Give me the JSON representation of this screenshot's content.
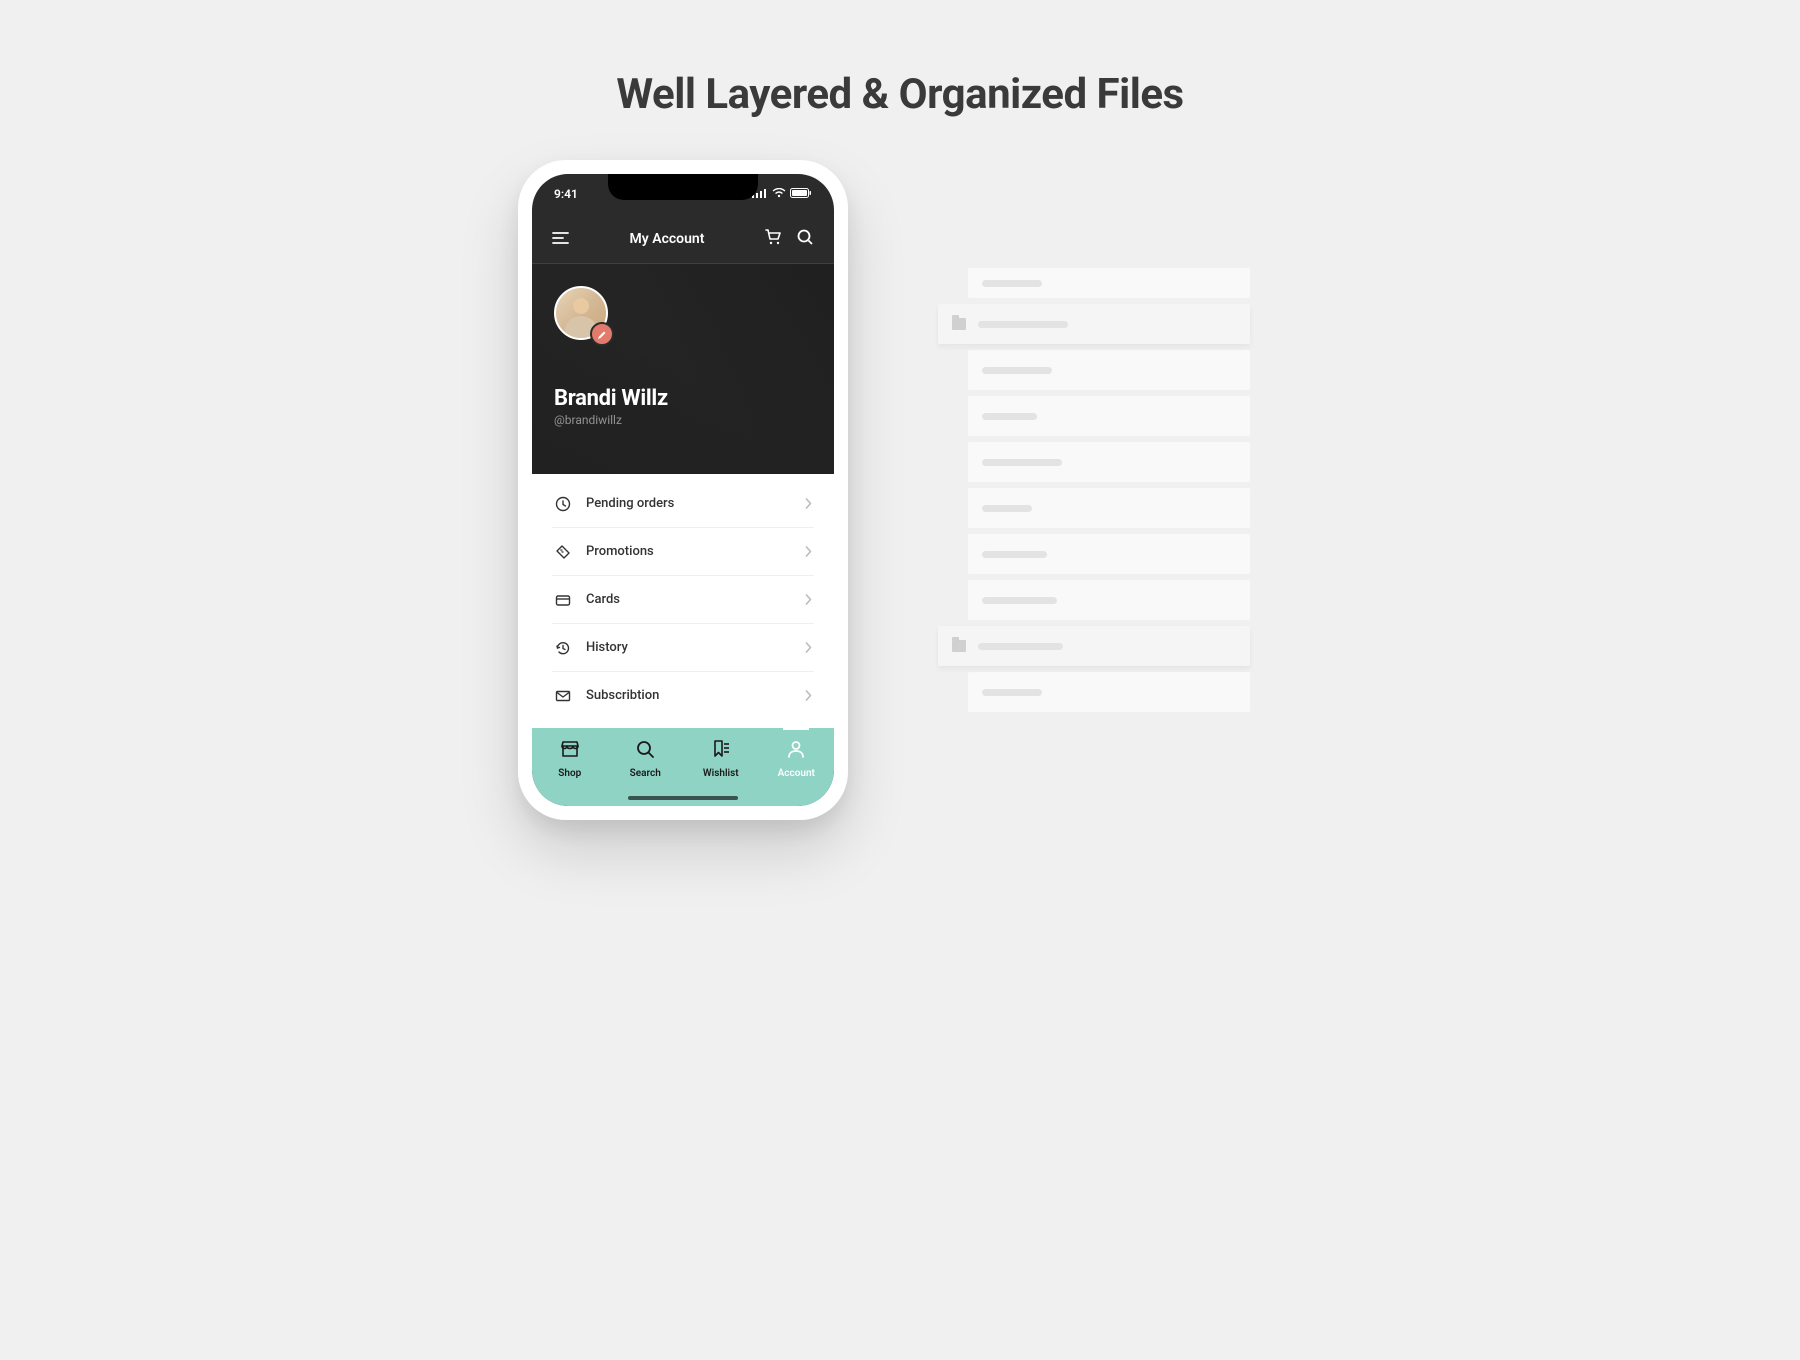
{
  "heading": "Well Layered & Organized Files",
  "statusbar": {
    "time": "9:41"
  },
  "topbar": {
    "title": "My Account"
  },
  "profile": {
    "name": "Brandi Willz",
    "handle": "@brandiwillz"
  },
  "menu": {
    "items": [
      {
        "icon": "clock-icon",
        "label": "Pending orders"
      },
      {
        "icon": "tag-icon",
        "label": "Promotions"
      },
      {
        "icon": "card-icon",
        "label": "Cards"
      },
      {
        "icon": "history-icon",
        "label": "History"
      },
      {
        "icon": "mail-icon",
        "label": "Subscribtion"
      }
    ]
  },
  "tabs": {
    "items": [
      {
        "icon": "shop-icon",
        "label": "Shop",
        "active": false
      },
      {
        "icon": "search-icon",
        "label": "Search",
        "active": false
      },
      {
        "icon": "wishlist-icon",
        "label": "Wishlist",
        "active": false
      },
      {
        "icon": "account-icon",
        "label": "Account",
        "active": true
      }
    ]
  },
  "colors": {
    "accent": "#8fd3c4",
    "edit_badge": "#e37b6d",
    "dark": "#2b2b2b"
  }
}
